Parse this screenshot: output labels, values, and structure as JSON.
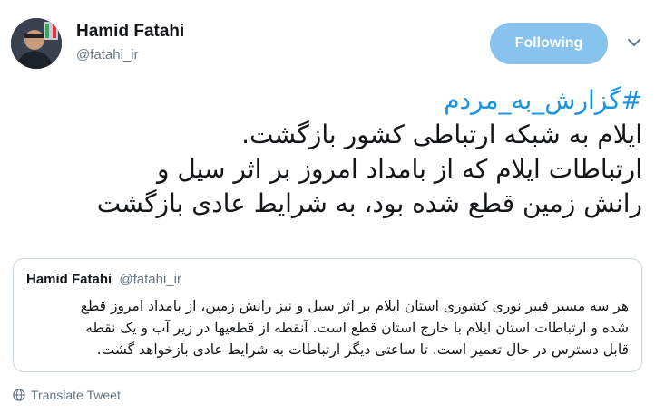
{
  "author": {
    "name": "Hamid Fatahi",
    "handle": "@fatahi_ir"
  },
  "follow_button": {
    "label": "Following",
    "color": "#87c3ec"
  },
  "tweet": {
    "hashtag": "#گزارش_به_مردم",
    "lines": [
      "ایلام به شبکه ارتباطی کشور بازگشت.",
      "ارتباطات ایلام که از بامداد امروز بر اثر سیل و",
      "رانش زمین قطع شده بود، به شرایط عادی بازگشت"
    ]
  },
  "quoted_tweet": {
    "name": "Hamid Fatahi",
    "handle": "@fatahi_ir",
    "lines": [
      "هر سه مسیر فیبر نوری کشوری استان ایلام بر اثر سیل و نیز رانش زمین، از بامداد امروز قطع",
      "شده و ارتباطات استان ایلام با خارج استان قطع است. آنقطه از قطعیها در زیر آب و یک نقطه",
      "قابل دسترس در حال تعمیر است. تا ساعتی دیگر ارتباطات به شرایط عادی بازخواهد گشت."
    ]
  },
  "translate": {
    "label": "Translate Tweet",
    "icon": "globe-icon"
  },
  "colors": {
    "link": "#1b95e0",
    "secondary_text": "#657786",
    "border": "#ccd6dd"
  }
}
